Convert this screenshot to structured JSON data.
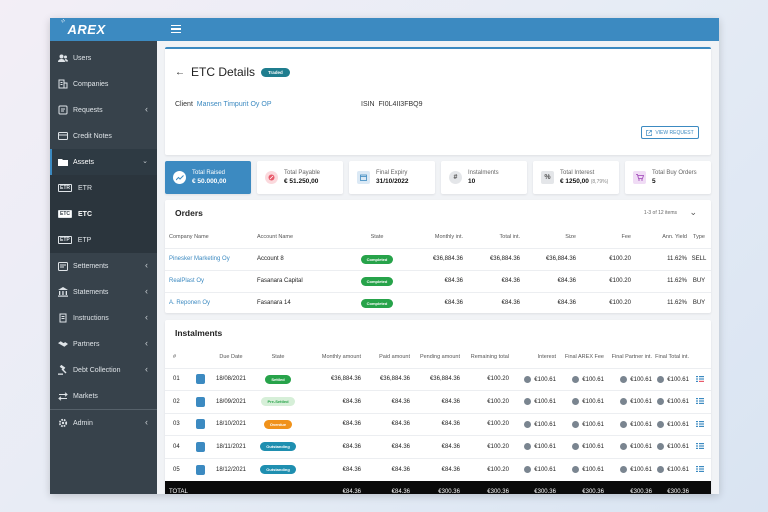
{
  "app": {
    "logo": "AREX"
  },
  "sidebar": {
    "items": [
      {
        "label": "Users",
        "icon": "users-icon"
      },
      {
        "label": "Companies",
        "icon": "building-icon"
      },
      {
        "label": "Requests",
        "icon": "requests-icon"
      },
      {
        "label": "Credit Notes",
        "icon": "card-icon"
      },
      {
        "label": "Assets",
        "icon": "folder-icon"
      },
      {
        "label": "Settements",
        "icon": "settlements-icon"
      },
      {
        "label": "Statements",
        "icon": "bank-icon"
      },
      {
        "label": "Instructions",
        "icon": "instructions-icon"
      },
      {
        "label": "Partners",
        "icon": "handshake-icon"
      },
      {
        "label": "Debt Collection",
        "icon": "gavel-icon"
      },
      {
        "label": "Markets",
        "icon": "arrows-icon"
      },
      {
        "label": "Admin",
        "icon": "gear-icon"
      }
    ],
    "assets_sub": [
      {
        "tag": "ETR",
        "label": "ETR"
      },
      {
        "tag": "ETC",
        "label": "ETC"
      },
      {
        "tag": "ETP",
        "label": "ETP"
      }
    ]
  },
  "etc": {
    "title": "ETC Details",
    "badge": "Traded",
    "client_label": "Client",
    "client_value": "Mansen Timpurit Oy OP",
    "isin_label": "ISIN",
    "isin_value": "FI0L4II3FBQ9",
    "view_request": "VIEW REQUEST"
  },
  "stats": [
    {
      "label": "Total Raised",
      "value": "€ 50.000,00",
      "extra": "",
      "icon": "trend-icon",
      "color": "#3c8ac1"
    },
    {
      "label": "Total Payable",
      "value": "€ 51.250,00",
      "extra": "",
      "icon": "payable-icon",
      "color": "#e85a6b"
    },
    {
      "label": "Final Expiry",
      "value": "31/10/2022",
      "extra": "",
      "icon": "calendar-icon",
      "color": "#3c8ac1"
    },
    {
      "label": "Instalments",
      "value": "10",
      "extra": "",
      "icon": "hash-icon",
      "color": "#555555"
    },
    {
      "label": "Total Interest",
      "value": "€ 1250,00",
      "extra": "(8,79%)",
      "icon": "percent-icon",
      "color": "#555555"
    },
    {
      "label": "Total Buy Orders",
      "value": "5",
      "extra": "",
      "icon": "cart-icon",
      "color": "#9b3fb5"
    }
  ],
  "orders": {
    "title": "Orders",
    "pager": "1-3 of 12 items",
    "columns": [
      "Company Name",
      "Account Name",
      "State",
      "Monthly int.",
      "Total int.",
      "Size",
      "Fee",
      "Ann. Yield",
      "Type"
    ],
    "rows": [
      {
        "company": "Pinesker Marketing Oy",
        "account": "Account 8",
        "state": "Completed",
        "monthly": "€36,884.36",
        "total": "€36,884.36",
        "size": "€36,884.36",
        "fee": "€100.20",
        "yield": "11.62%",
        "type": "SELL"
      },
      {
        "company": "RealPlast Oy",
        "account": "Fasanara Capital",
        "state": "Completed",
        "monthly": "€84.36",
        "total": "€84.36",
        "size": "€84.36",
        "fee": "€100.20",
        "yield": "11.62%",
        "type": "BUY"
      },
      {
        "company": "A. Reponen Oy",
        "account": "Fasanara 14",
        "state": "Completed",
        "monthly": "€84.36",
        "total": "€84.36",
        "size": "€84.36",
        "fee": "€100.20",
        "yield": "11.62%",
        "type": "BUY"
      }
    ]
  },
  "instalments": {
    "title": "Instalments",
    "columns": [
      "#",
      "Due Date",
      "State",
      "Monthly amount",
      "Paid amount",
      "Pending amount",
      "Remaining total",
      "Interest",
      "Final AREX Fee",
      "Final Partner int.",
      "Final Total int."
    ],
    "rows": [
      {
        "n": "01",
        "due": "18/08/2021",
        "state": "Settled",
        "cls": "settled",
        "monthly": "€36,884.36",
        "paid": "€36,884.36",
        "pending": "€36,884.36",
        "remaining": "€100.20",
        "interest": "€100.61",
        "arex": "€100.61",
        "partner": "€100.61",
        "total": "€100.61"
      },
      {
        "n": "02",
        "due": "18/09/2021",
        "state": "Pre-Settled",
        "cls": "presettled",
        "monthly": "€84.36",
        "paid": "€84.36",
        "pending": "€84.36",
        "remaining": "€100.20",
        "interest": "€100.61",
        "arex": "€100.61",
        "partner": "€100.61",
        "total": "€100.61"
      },
      {
        "n": "03",
        "due": "18/10/2021",
        "state": "Overdue",
        "cls": "overdue",
        "monthly": "€84.36",
        "paid": "€84.36",
        "pending": "€84.36",
        "remaining": "€100.20",
        "interest": "€100.61",
        "arex": "€100.61",
        "partner": "€100.61",
        "total": "€100.61"
      },
      {
        "n": "04",
        "due": "18/11/2021",
        "state": "Outstanding",
        "cls": "outstanding",
        "monthly": "€84.36",
        "paid": "€84.36",
        "pending": "€84.36",
        "remaining": "€100.20",
        "interest": "€100.61",
        "arex": "€100.61",
        "partner": "€100.61",
        "total": "€100.61"
      },
      {
        "n": "05",
        "due": "18/12/2021",
        "state": "Outstanding",
        "cls": "outstanding",
        "monthly": "€84.36",
        "paid": "€84.36",
        "pending": "€84.36",
        "remaining": "€100.20",
        "interest": "€100.61",
        "arex": "€100.61",
        "partner": "€100.61",
        "total": "€100.61"
      }
    ],
    "total": {
      "label": "TOTAL",
      "monthly": "€84.36",
      "paid": "€84.36",
      "pending": "€300.36",
      "remaining": "€300.36",
      "interest": "€300.36",
      "arex": "€300.36",
      "partner": "€300.36",
      "total": "€300.36"
    }
  }
}
